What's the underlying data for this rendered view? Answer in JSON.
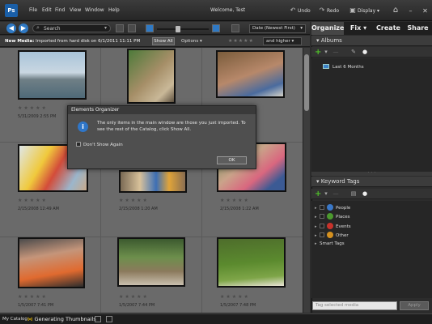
{
  "titlebar": {
    "logo": "Ps",
    "menu": [
      "File",
      "Edit",
      "Find",
      "View",
      "Window",
      "Help"
    ],
    "welcome": "Welcome, Test",
    "undo": "Undo",
    "redo": "Redo",
    "display": "Display"
  },
  "toolbar": {
    "search_label": "Search",
    "sort_value": "Date (Newest First)"
  },
  "infobar": {
    "new_media_label": "New Media:",
    "new_media_text": "Imported from hard disk on 6/1/2011 11:11 PM",
    "show_all": "Show All",
    "options": "Options",
    "rating_filter": "and higher"
  },
  "grid": {
    "items": [
      {
        "date": "5/31/2009 2:55 PM"
      },
      {
        "date": ""
      },
      {
        "date": ""
      },
      {
        "date": "2/15/2008 12:49 AM"
      },
      {
        "date": "2/15/2008 1:20 AM"
      },
      {
        "date": "2/15/2008 1:22 AM"
      },
      {
        "date": "1/5/2007 7:41 PM"
      },
      {
        "date": "1/5/2007 7:44 PM"
      },
      {
        "date": "1/5/2007 7:48 PM"
      }
    ]
  },
  "dialog": {
    "title": "Elements Organizer",
    "message": "The only items in the main window are those you just imported. To see the rest of the Catalog, click Show All.",
    "checkbox_label": "Don't Show Again",
    "ok": "OK"
  },
  "right_panel": {
    "tabs": [
      "Organize",
      "Fix",
      "Create",
      "Share"
    ],
    "albums_header": "Albums",
    "album_item": "Last 6 Months",
    "keyword_header": "Keyword Tags",
    "tags": [
      "People",
      "Places",
      "Events",
      "Other",
      "Smart Tags"
    ],
    "tag_colors": [
      "#3a78c8",
      "#4c9a2e",
      "#c8322b",
      "#d4901f"
    ],
    "tag_search_placeholder": "Tag selected media",
    "apply": "Apply"
  },
  "statusbar": {
    "catalog": "My Catalog",
    "generating": "Generating Thumbnails"
  }
}
